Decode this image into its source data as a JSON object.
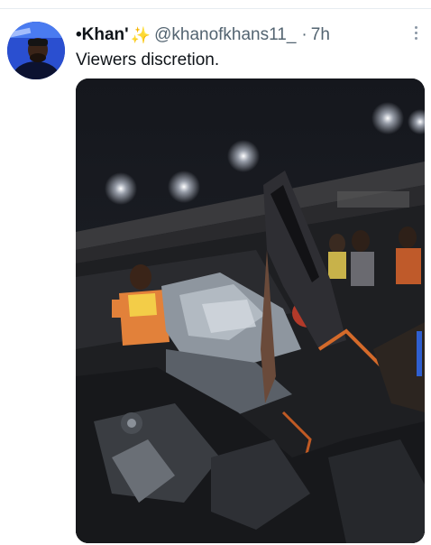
{
  "tweet": {
    "display_name": "•Khan'",
    "handle": "@khanofkhans11_",
    "separator": "·",
    "time": "7h",
    "text": "Viewers discretion.",
    "more_icon": "more-horizontal-icon",
    "sparkle_icon": "sparkles-emoji"
  },
  "colors": {
    "text": "#0f1419",
    "secondary": "#536471",
    "divider": "#e6ecf0",
    "avatar_bg": "#1a3fa0"
  }
}
